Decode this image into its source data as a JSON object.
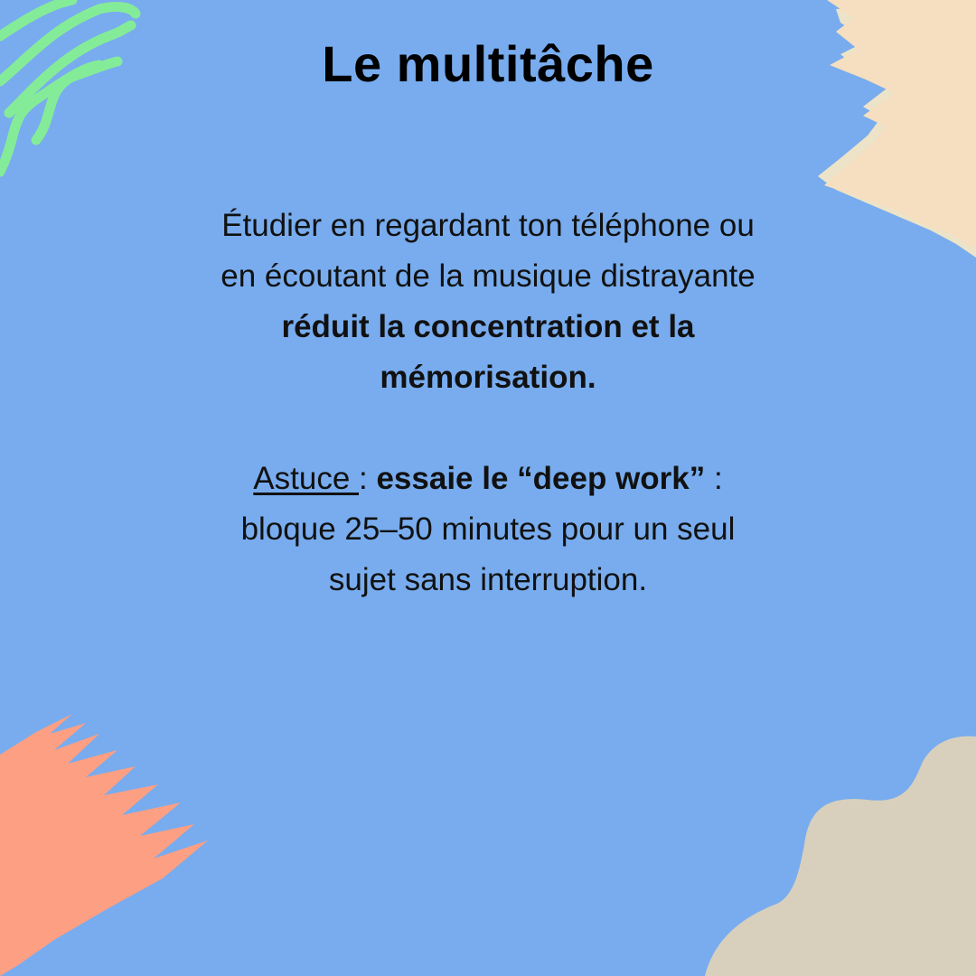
{
  "colors": {
    "background": "#78acee",
    "green_waves": "#84ec98",
    "cream_brush": "#f5dfc0",
    "coral_brush": "#fd9f83",
    "sand_blob": "#d8d0bd",
    "text": "#000000"
  },
  "title": "Le multitâche",
  "paragraph1": {
    "line1": "Étudier en regardant ton téléphone ou",
    "line2": "en écoutant de la musique distrayante",
    "bold_line1": "réduit la concentration et la",
    "bold_line2": "mémorisation."
  },
  "tip": {
    "label": "Astuce ",
    "separator": " : ",
    "bold": "essaie le “deep work”",
    "colon": " :",
    "line2": "bloque 25–50 minutes pour un seul",
    "line3": "sujet sans interruption."
  }
}
